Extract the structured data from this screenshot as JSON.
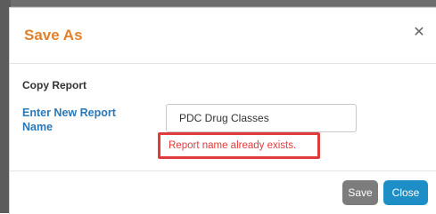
{
  "dialog": {
    "title": "Save As",
    "close_icon": "close-icon",
    "section_title": "Copy Report",
    "field_label": "Enter New Report Name",
    "input_value": "PDC Drug Classes",
    "error_message": "Report name already exists.",
    "save_label": "Save",
    "close_label": "Close"
  },
  "colors": {
    "title": "#e0822c",
    "label": "#2a78b8",
    "error": "#e03b3b",
    "save_button": "#7c7c7c",
    "close_button": "#1e8fc6"
  }
}
